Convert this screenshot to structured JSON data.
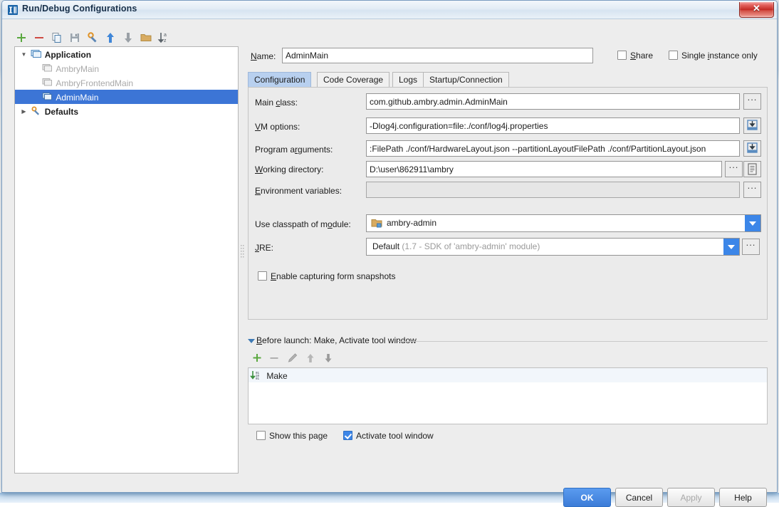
{
  "window": {
    "title": "Run/Debug Configurations",
    "close_label": "✕",
    "app_icon": "intellij-idea-icon"
  },
  "tree_toolbar": {
    "buttons": [
      {
        "name": "add-configuration-button",
        "icon": "plus-icon",
        "tooltip": "Add New Configuration"
      },
      {
        "name": "remove-configuration-button",
        "icon": "minus-icon",
        "tooltip": "Remove Configuration"
      },
      {
        "name": "copy-configuration-button",
        "icon": "copy-icon",
        "tooltip": "Copy Configuration"
      },
      {
        "name": "save-configuration-button",
        "icon": "save-icon",
        "tooltip": "Save Configuration"
      },
      {
        "name": "edit-defaults-button",
        "icon": "wrench-icon",
        "tooltip": "Edit defaults"
      },
      {
        "name": "move-up-button",
        "icon": "arrow-up-icon",
        "tooltip": "Move Up"
      },
      {
        "name": "move-down-button",
        "icon": "arrow-down-icon",
        "tooltip": "Move Down"
      },
      {
        "name": "create-folder-button",
        "icon": "folder-icon",
        "tooltip": "Create New Folder"
      },
      {
        "name": "sort-alphabetically-button",
        "icon": "sort-az-icon",
        "tooltip": "Sort Configurations"
      }
    ]
  },
  "tree": {
    "nodes": [
      {
        "label": "Application",
        "icon": "application-group-icon",
        "expander": "expanded",
        "style": "bold",
        "indent": 0,
        "selected": false
      },
      {
        "label": "AmbryMain",
        "icon": "application-icon",
        "expander": "none",
        "style": "dim",
        "indent": 1,
        "selected": false
      },
      {
        "label": "AmbryFrontendMain",
        "icon": "application-icon",
        "expander": "none",
        "style": "dim",
        "indent": 1,
        "selected": false
      },
      {
        "label": "AdminMain",
        "icon": "application-icon",
        "expander": "none",
        "style": "normal",
        "indent": 1,
        "selected": true
      },
      {
        "label": "Defaults",
        "icon": "defaults-wrench-icon",
        "expander": "collapsed",
        "style": "bold",
        "indent": 0,
        "selected": false
      }
    ]
  },
  "header": {
    "name_label": "Name:",
    "name_label_mnemonic": "N",
    "name_value": "AdminMain",
    "share_label": "Share",
    "share_checked": false,
    "single_instance_label": "Single instance only",
    "single_instance_checked": false
  },
  "tabs": [
    {
      "label": "Configuration",
      "active": true
    },
    {
      "label": "Code Coverage",
      "active": false
    },
    {
      "label": "Logs",
      "active": false
    },
    {
      "label": "Startup/Connection",
      "active": false
    }
  ],
  "configuration": {
    "main_class": {
      "label": "Main class:",
      "value": "com.github.ambry.admin.AdminMain",
      "browse_label": "..."
    },
    "vm_options": {
      "label": "VM options:",
      "value": "-Dlog4j.configuration=file:./conf/log4j.properties",
      "expand_icon": "expand-editor-icon"
    },
    "program_arguments": {
      "label": "Program arguments:",
      "value": ":FilePath ./conf/HardwareLayout.json --partitionLayoutFilePath ./conf/PartitionLayout.json",
      "expand_icon": "expand-editor-icon"
    },
    "working_directory": {
      "label": "Working directory:",
      "value": "D:\\user\\862911\\ambry",
      "browse_label": "...",
      "macros_icon": "macros-list-icon"
    },
    "environment_variables": {
      "label": "Environment variables:",
      "value": "",
      "disabled": true,
      "browse_label": "..."
    },
    "classpath_module": {
      "label": "Use classpath of module:",
      "value": "ambry-admin",
      "icon": "module-folder-icon"
    },
    "jre": {
      "label": "JRE:",
      "value_primary": "Default",
      "value_secondary": "(1.7 - SDK of 'ambry-admin' module)",
      "browse_label": "..."
    },
    "form_snapshots": {
      "label": "Enable capturing form snapshots",
      "checked": false
    }
  },
  "before_launch": {
    "title_prefix": "B",
    "title_rest": "efore launch: Make, Activate tool window",
    "toolbar": [
      {
        "name": "add-task-button",
        "icon": "plus-icon"
      },
      {
        "name": "remove-task-button",
        "icon": "minus-icon"
      },
      {
        "name": "edit-task-button",
        "icon": "pencil-icon"
      },
      {
        "name": "move-task-up-button",
        "icon": "arrow-up-icon"
      },
      {
        "name": "move-task-down-button",
        "icon": "arrow-down-icon"
      }
    ],
    "tasks": [
      {
        "label": "Make",
        "icon": "make-compile-icon"
      }
    ],
    "show_this_page": {
      "label": "Show this page",
      "checked": false
    },
    "activate_tool_window": {
      "label": "Activate tool window",
      "checked": true
    }
  },
  "footer": {
    "ok": "OK",
    "cancel": "Cancel",
    "apply": "Apply",
    "apply_disabled": true,
    "help": "Help"
  },
  "colors": {
    "selection_blue": "#3c75d6",
    "accent_blue": "#3c86e8",
    "tab_active": "#b8d0ef",
    "dialog_bg": "#ededed",
    "panel_bg": "#ebebeb",
    "disabled_text": "#a8a8a8"
  }
}
